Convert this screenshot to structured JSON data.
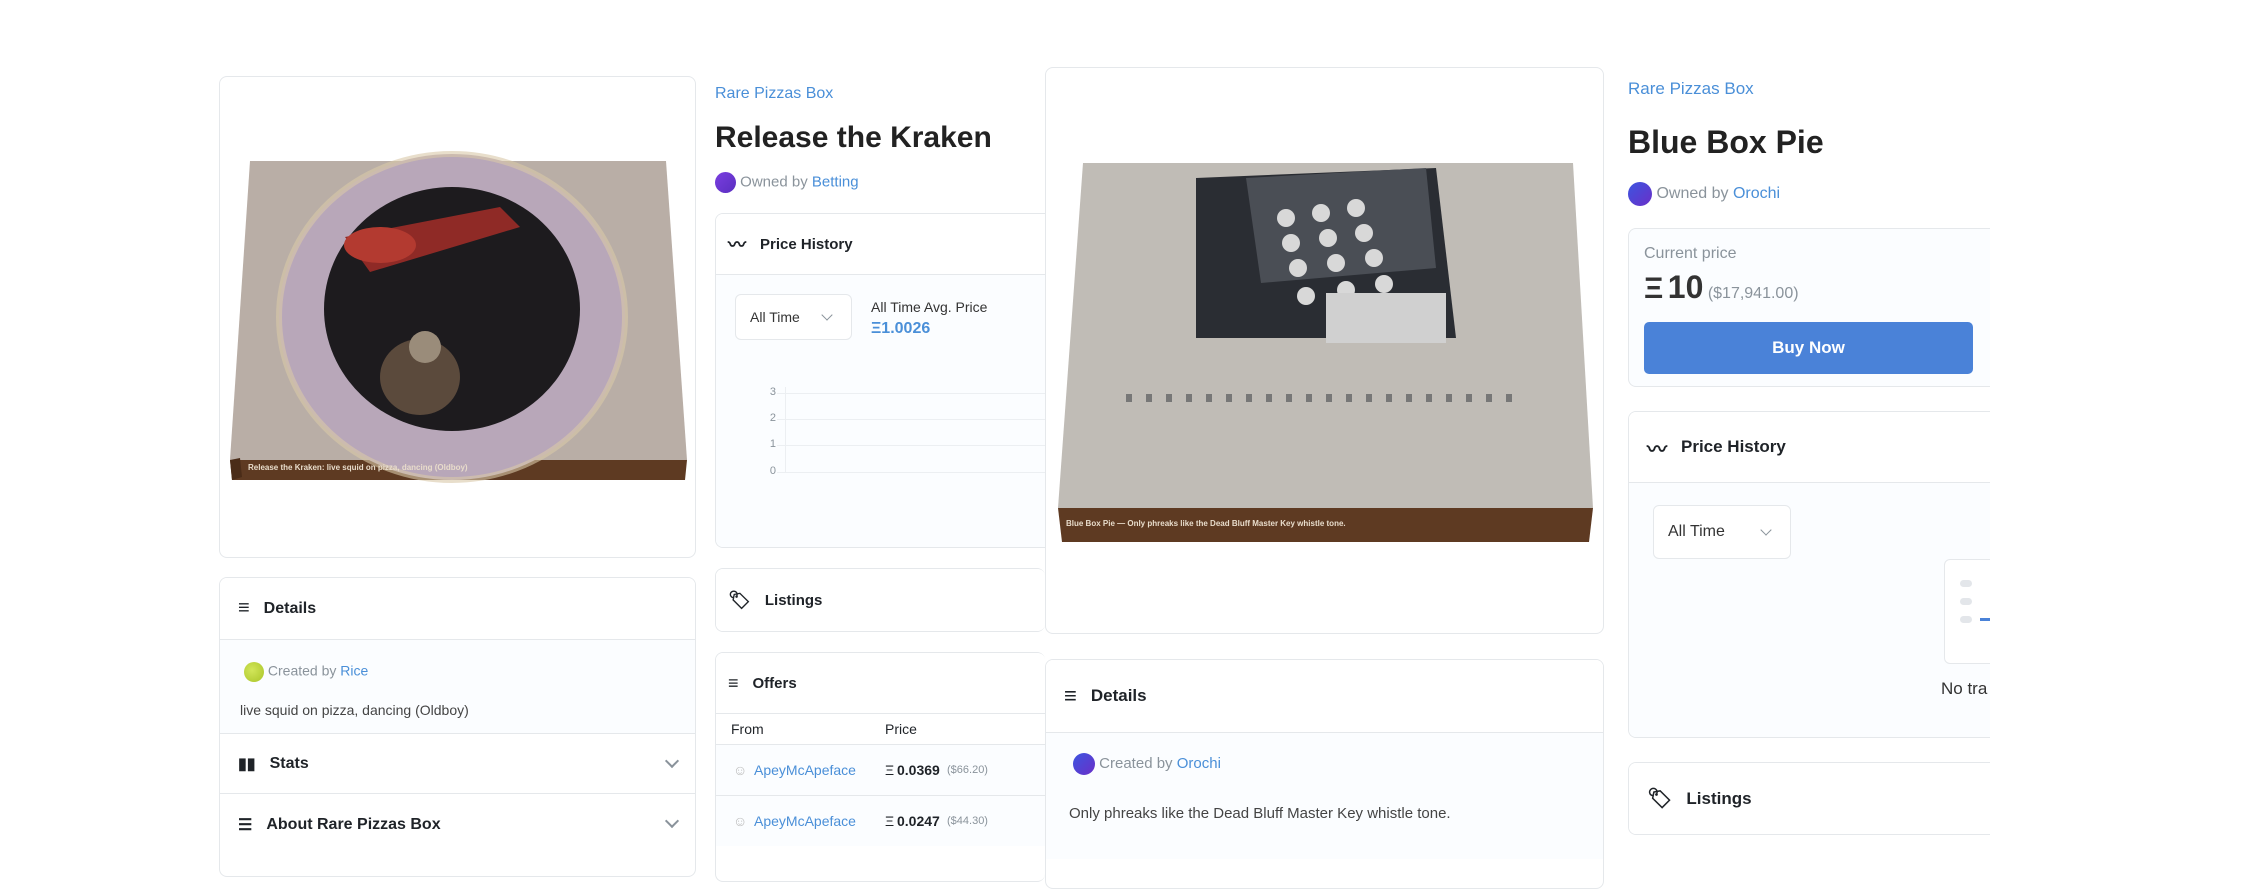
{
  "item1": {
    "collection": "Rare Pizzas Box",
    "title": "Release the Kraken",
    "owned_prefix": "Owned by",
    "owner": "Betting",
    "box_caption": "Release the Kraken: live squid on pizza, dancing (Oldboy)",
    "details": {
      "title": "Details",
      "created_prefix": "Created by",
      "creator": "Rice",
      "description": "live squid on pizza, dancing (Oldboy)"
    },
    "stats_label": "Stats",
    "about_label": "About Rare Pizzas Box",
    "price_history": {
      "title": "Price History",
      "range": "All Time",
      "avg_label": "All Time Avg. Price",
      "avg_value": "Ξ1.0026",
      "y_ticks": [
        "3",
        "2",
        "1",
        "0"
      ]
    },
    "listings_label": "Listings",
    "offers": {
      "title": "Offers",
      "columns": [
        "From",
        "Price"
      ],
      "rows": [
        {
          "from": "ApeyMcApeface",
          "price": "0.0369",
          "usd": "($66.20)"
        },
        {
          "from": "ApeyMcApeface",
          "price": "0.0247",
          "usd": "($44.30)"
        }
      ]
    }
  },
  "item2": {
    "collection": "Rare Pizzas Box",
    "title": "Blue Box Pie",
    "owned_prefix": "Owned by",
    "owner": "Orochi",
    "box_caption": "Blue Box Pie — Only phreaks like the Dead Bluff Master Key whistle tone.",
    "current_price_label": "Current price",
    "price_symbol": "Ξ",
    "price": "10",
    "price_usd": "($17,941.00)",
    "buy_label": "Buy Now",
    "price_history": {
      "title": "Price History",
      "range": "All Time",
      "empty_text": "No tra"
    },
    "listings_label": "Listings",
    "details": {
      "title": "Details",
      "created_prefix": "Created by",
      "creator": "Orochi",
      "description": "Only phreaks like the Dead Bluff Master Key whistle tone."
    }
  },
  "colors": {
    "link": "#4a8fd8",
    "button": "#4a82d8",
    "owner_avatar_1": "#6b3fd8",
    "owner_avatar_2": "#4a4fe0",
    "creator_avatar_1": "#b5d43a"
  }
}
